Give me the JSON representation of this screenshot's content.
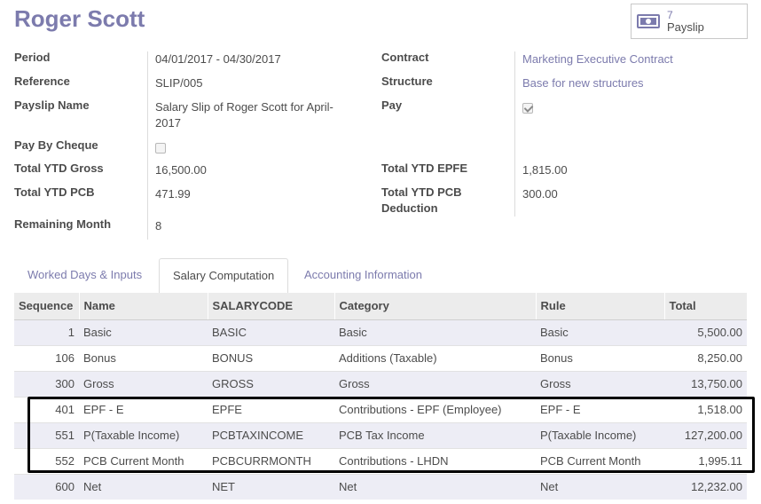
{
  "header": {
    "title": "Roger Scott"
  },
  "smart_button": {
    "count": "7",
    "label": "Payslip",
    "icon": "money-icon"
  },
  "form": {
    "period_label": "Period",
    "period_value": "04/01/2017 - 04/30/2017",
    "reference_label": "Reference",
    "reference_value": "SLIP/005",
    "payslip_name_label": "Payslip Name",
    "payslip_name_line1": "Salary Slip of Roger Scott for April-",
    "payslip_name_line2": "2017",
    "pay_by_cheque_label": "Pay By Cheque",
    "pay_by_cheque_checked": false,
    "ytd_gross_label": "Total YTD Gross",
    "ytd_gross_value": "16,500.00",
    "ytd_pcb_label": "Total YTD PCB",
    "ytd_pcb_value": "471.99",
    "remaining_month_label": "Remaining Month",
    "remaining_month_value": "8",
    "contract_label": "Contract",
    "contract_value": "Marketing Executive Contract",
    "structure_label": "Structure",
    "structure_value": "Base for new structures",
    "pay_label": "Pay",
    "pay_checked": true,
    "ytd_epfe_label": "Total YTD EPFE",
    "ytd_epfe_value": "1,815.00",
    "ytd_pcb_deduction_label_line1": "Total YTD PCB",
    "ytd_pcb_deduction_label_line2": "Deduction",
    "ytd_pcb_deduction_value": "300.00"
  },
  "tabs": [
    {
      "label": "Worked Days & Inputs"
    },
    {
      "label": "Salary Computation"
    },
    {
      "label": "Accounting Information"
    }
  ],
  "table": {
    "headers": [
      "Sequence",
      "Name",
      "SALARYCODE",
      "Category",
      "Rule",
      "Total"
    ],
    "rows": [
      [
        "1",
        "Basic",
        "BASIC",
        "Basic",
        "Basic",
        "5,500.00"
      ],
      [
        "106",
        "Bonus",
        "BONUS",
        "Additions (Taxable)",
        "Bonus",
        "8,250.00"
      ],
      [
        "300",
        "Gross",
        "GROSS",
        "Gross",
        "Gross",
        "13,750.00"
      ],
      [
        "401",
        "EPF - E",
        "EPFE",
        "Contributions - EPF (Employee)",
        "EPF - E",
        "1,518.00"
      ],
      [
        "551",
        "P(Taxable Income)",
        "PCBTAXINCOME",
        "PCB Tax Income",
        "P(Taxable Income)",
        "127,200.00"
      ],
      [
        "552",
        "PCB Current Month",
        "PCBCURRMONTH",
        "Contributions - LHDN",
        "PCB Current Month",
        "1,995.11"
      ],
      [
        "600",
        "Net",
        "NET",
        "Net",
        "Net",
        "12,232.00"
      ]
    ]
  },
  "colors": {
    "accent": "#7c7bad",
    "highlight_border": "#000000"
  }
}
